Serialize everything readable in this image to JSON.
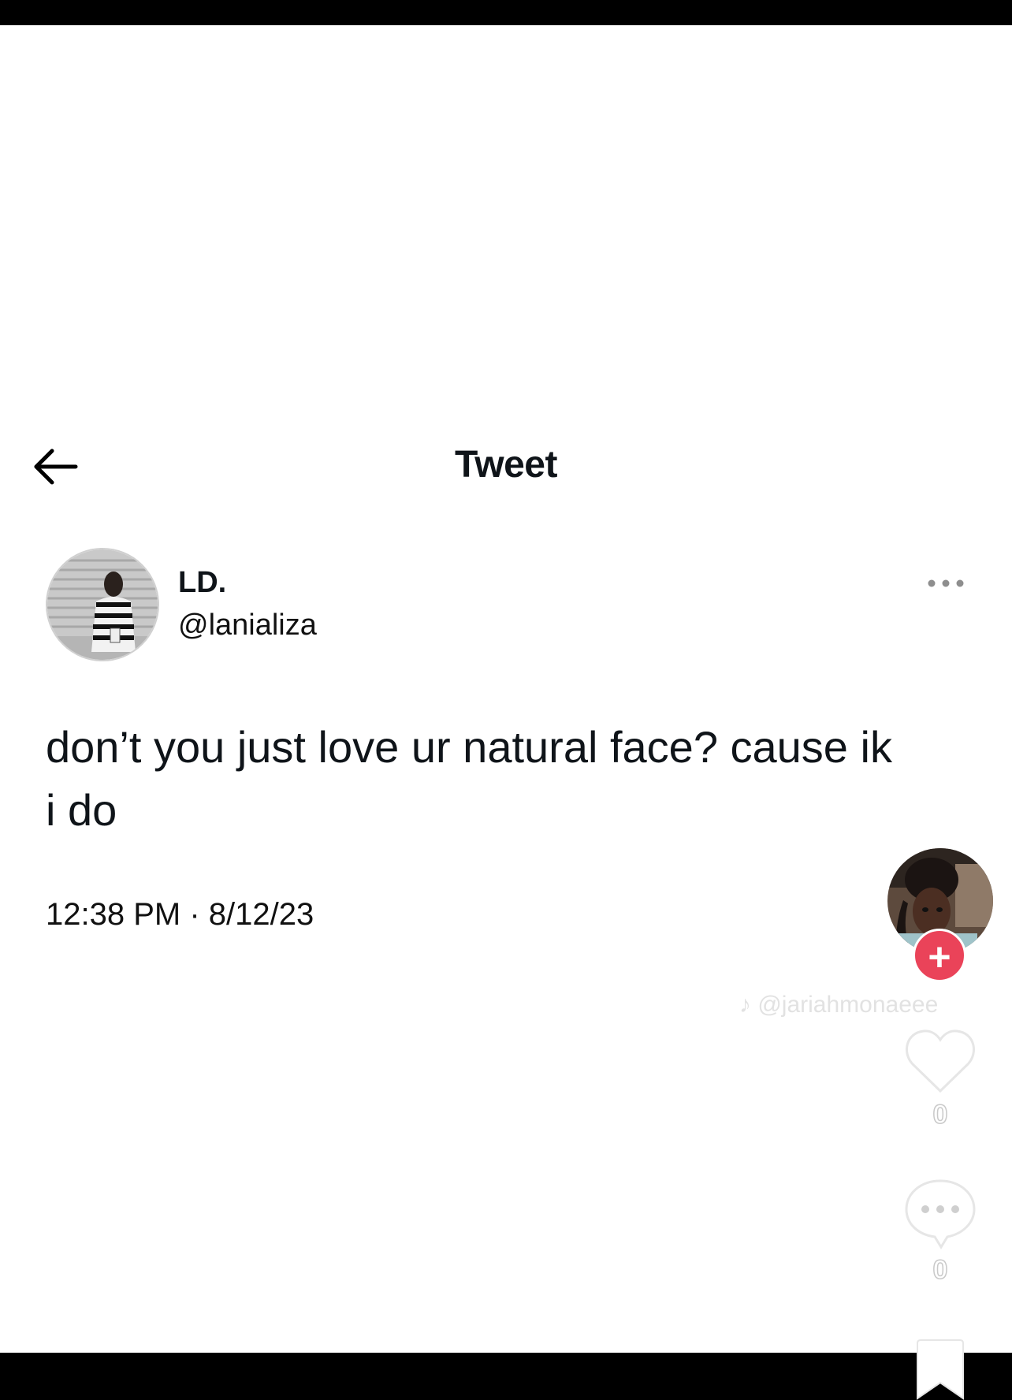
{
  "header": {
    "title": "Tweet",
    "back_icon": "arrow-left-icon"
  },
  "tweet": {
    "author_name": "LD.",
    "author_handle": "@lanializa",
    "text_line1": "don’t you just love ur natural face? cause ik",
    "text_line2": "i do",
    "timestamp": "12:38 PM · 8/12/23",
    "more_icon": "ellipsis-icon"
  },
  "overlay": {
    "follow_label": "+",
    "watermark": "@jariahmonaeee",
    "likes": "0",
    "comments": "0",
    "accent_color": "#ea4359",
    "icons": [
      "heart-icon",
      "comment-bubble-icon",
      "bookmark-icon",
      "tiktok-logo-icon"
    ]
  }
}
